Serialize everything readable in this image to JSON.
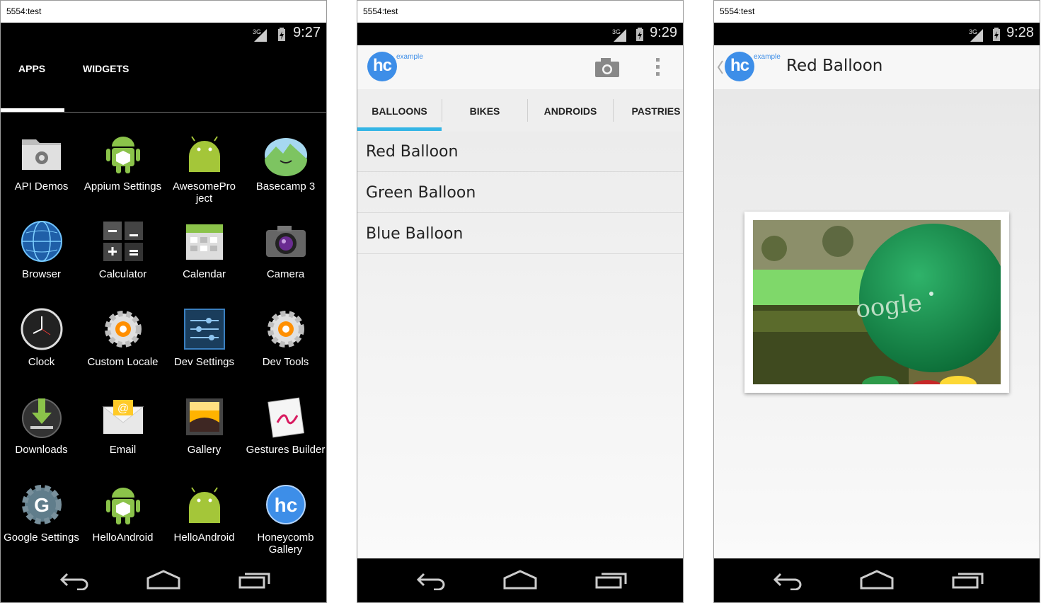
{
  "windows": [
    {
      "title": "5554:test",
      "time": "9:27"
    },
    {
      "title": "5554:test",
      "time": "9:29"
    },
    {
      "title": "5554:test",
      "time": "9:28"
    }
  ],
  "status": {
    "network": "3G"
  },
  "drawer": {
    "tabs": [
      "APPS",
      "WIDGETS"
    ],
    "apps": [
      {
        "label": "API Demos",
        "icon": "folder-gear-icon"
      },
      {
        "label": "Appium Settings",
        "icon": "android-robot-icon"
      },
      {
        "label": "AwesomePro ject",
        "icon": "android-head-icon"
      },
      {
        "label": "Basecamp 3",
        "icon": "basecamp-icon"
      },
      {
        "label": "Browser",
        "icon": "globe-icon"
      },
      {
        "label": "Calculator",
        "icon": "calculator-icon"
      },
      {
        "label": "Calendar",
        "icon": "calendar-icon"
      },
      {
        "label": "Camera",
        "icon": "camera-icon"
      },
      {
        "label": "Clock",
        "icon": "clock-icon"
      },
      {
        "label": "Custom Locale",
        "icon": "gear-orange-icon"
      },
      {
        "label": "Dev Settings",
        "icon": "sliders-icon"
      },
      {
        "label": "Dev Tools",
        "icon": "gear-orange-icon"
      },
      {
        "label": "Downloads",
        "icon": "download-icon"
      },
      {
        "label": "Email",
        "icon": "email-icon"
      },
      {
        "label": "Gallery",
        "icon": "gallery-icon"
      },
      {
        "label": "Gestures Builder",
        "icon": "gesture-icon"
      },
      {
        "label": "Google Settings",
        "icon": "google-gear-icon"
      },
      {
        "label": "HelloAndroid",
        "icon": "android-robot-icon"
      },
      {
        "label": "HelloAndroid",
        "icon": "android-head-icon"
      },
      {
        "label": "Honeycomb Gallery",
        "icon": "hc-icon"
      }
    ]
  },
  "gallery": {
    "logo_text": "hc",
    "logo_sub": "example",
    "tabs": [
      "BALLOONS",
      "BIKES",
      "ANDROIDS",
      "PASTRIES"
    ],
    "items": [
      "Red Balloon",
      "Green Balloon",
      "Blue Balloon"
    ]
  },
  "detail": {
    "title": "Red Balloon",
    "photo_text": "oogle"
  },
  "colors": {
    "accent": "#33b5e5",
    "logo_blue": "#3d8ee8"
  }
}
